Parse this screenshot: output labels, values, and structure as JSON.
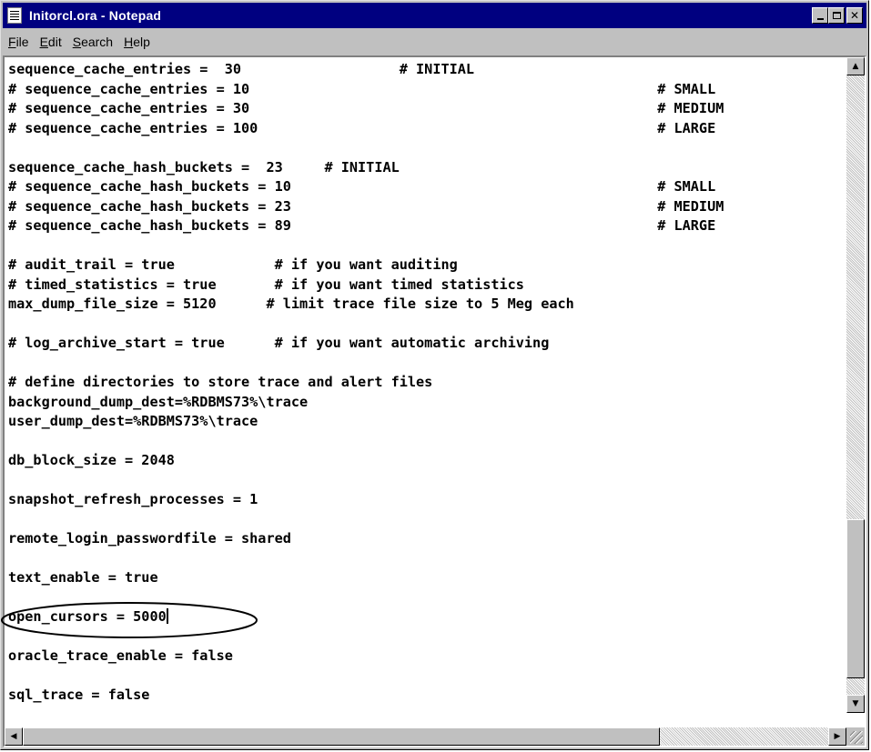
{
  "window": {
    "title": "Initorcl.ora - Notepad",
    "icon": "notepad-icon",
    "controls": [
      "minimize-icon",
      "maximize-icon",
      "close-icon"
    ]
  },
  "menu": [
    {
      "label": "File",
      "accel": "F",
      "rest": "ile"
    },
    {
      "label": "Edit",
      "accel": "E",
      "rest": "dit"
    },
    {
      "label": "Search",
      "accel": "S",
      "rest": "earch"
    },
    {
      "label": "Help",
      "accel": "H",
      "rest": "elp"
    }
  ],
  "editor": {
    "lines": [
      "sequence_cache_entries =  30                   # INITIAL",
      "# sequence_cache_entries = 10                                                 # SMALL",
      "# sequence_cache_entries = 30                                                 # MEDIUM",
      "# sequence_cache_entries = 100                                                # LARGE",
      "",
      "sequence_cache_hash_buckets =  23     # INITIAL",
      "# sequence_cache_hash_buckets = 10                                            # SMALL",
      "# sequence_cache_hash_buckets = 23                                            # MEDIUM",
      "# sequence_cache_hash_buckets = 89                                            # LARGE",
      "",
      "# audit_trail = true            # if you want auditing",
      "# timed_statistics = true       # if you want timed statistics",
      "max_dump_file_size = 5120      # limit trace file size to 5 Meg each",
      "",
      "# log_archive_start = true      # if you want automatic archiving",
      "",
      "# define directories to store trace and alert files",
      "background_dump_dest=%RDBMS73%\\trace",
      "user_dump_dest=%RDBMS73%\\trace",
      "",
      "db_block_size = 2048",
      "",
      "snapshot_refresh_processes = 1",
      "",
      "remote_login_passwordfile = shared",
      "",
      "text_enable = true",
      "",
      "open_cursors = 5000",
      "",
      "oracle_trace_enable = false",
      "",
      "sql_trace = false"
    ],
    "caret_line_index": 28
  },
  "annotation": {
    "type": "ellipse-highlight",
    "target_text": "open_cursors = 5000",
    "color": "#000000"
  },
  "colors": {
    "titlebar": "#000080",
    "chrome": "#c0c0c0",
    "text": "#000000"
  }
}
